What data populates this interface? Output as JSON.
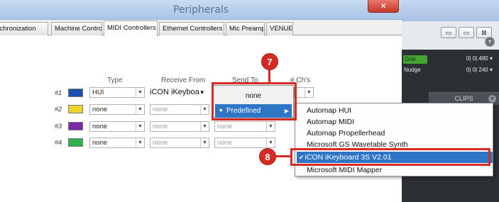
{
  "window": {
    "title": "Peripherals",
    "close_glyph": "×"
  },
  "tabs": [
    {
      "label": "Synchronization"
    },
    {
      "label": "Machine Control"
    },
    {
      "label": "MIDI Controllers"
    },
    {
      "label": "Ethernet Controllers"
    },
    {
      "label": "Mic Preamps"
    },
    {
      "label": "VENUE"
    }
  ],
  "headers": {
    "type": "Type",
    "receive_from": "Receive From",
    "send_to": "Send To",
    "chs": "# Ch's"
  },
  "rows": [
    {
      "num": "#1",
      "color": "#1c4fb0",
      "type": "HUI",
      "receive": "iCON iKeyboa",
      "send": "",
      "chs": ""
    },
    {
      "num": "#2",
      "color": "#f0d22c",
      "type": "none",
      "receive": "none",
      "send": "none",
      "chs": ""
    },
    {
      "num": "#3",
      "color": "#7a2aa6",
      "type": "none",
      "receive": "none",
      "send": "none",
      "chs": ""
    },
    {
      "num": "#4",
      "color": "#2fb04a",
      "type": "none",
      "receive": "none",
      "send": "none",
      "chs": ""
    }
  ],
  "dropdown": {
    "none_label": "none",
    "predefined_label": "Predefined"
  },
  "submenu": {
    "items": [
      "Automap HUI",
      "Automap MIDI",
      "Automap Propellerhead",
      "Microsoft GS Wavetable Synth",
      "iCON iKeyboard 3S V2.01",
      "Microsoft MIDI Mapper"
    ],
    "selected_index": 4,
    "check_glyph": "✔"
  },
  "callouts": {
    "step7": "7",
    "step8": "8"
  },
  "protools": {
    "row1_badge": "Grid",
    "row1_counter": "0| 0| 480 ▾",
    "row2_label": "Nudge",
    "row2_counter": "0| 0| 240 ▾",
    "clips_label": "CLIPS",
    "window_buttons": [
      "▭",
      "▭",
      "⊠"
    ]
  },
  "colors": {
    "highlight_blue": "#2f75c6",
    "callout_red": "#d52b24"
  }
}
